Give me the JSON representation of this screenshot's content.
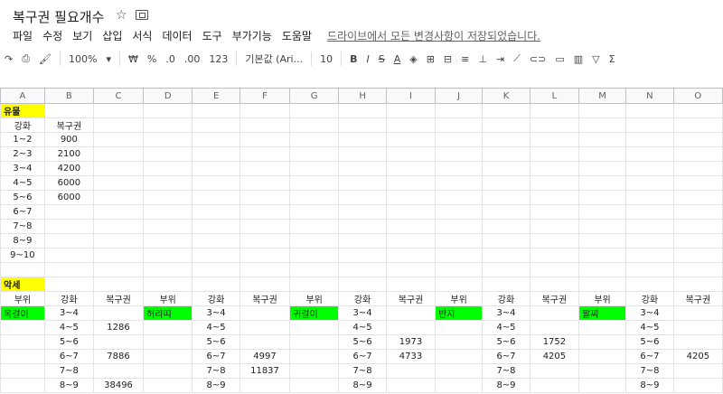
{
  "title": "복구권 필요개수",
  "menu": [
    "파일",
    "수정",
    "보기",
    "삽입",
    "서식",
    "데이터",
    "도구",
    "부가기능",
    "도움말"
  ],
  "save_status": "드라이브에서 모든 변경사항이 저장되었습니다.",
  "toolbar": {
    "zoom": "100%",
    "currency": "₩",
    "percent": "%",
    "dec_less": ".0",
    "dec_more": ".00",
    "format_more": "123",
    "font": "기본값 (Ari...",
    "font_size": "10"
  },
  "columns": [
    "A",
    "B",
    "C",
    "D",
    "E",
    "F",
    "G",
    "H",
    "I",
    "J",
    "K",
    "L",
    "M",
    "N",
    "O"
  ],
  "section1": {
    "label": "유물",
    "header": [
      "강화",
      "복구권"
    ],
    "rows": [
      [
        "1~2",
        "900"
      ],
      [
        "2~3",
        "2100"
      ],
      [
        "3~4",
        "4200"
      ],
      [
        "4~5",
        "6000"
      ],
      [
        "5~6",
        "6000"
      ],
      [
        "6~7",
        ""
      ],
      [
        "7~8",
        ""
      ],
      [
        "8~9",
        ""
      ],
      [
        "9~10",
        ""
      ]
    ]
  },
  "section2": {
    "label": "악세",
    "group_header": [
      "부위",
      "강화",
      "복구권"
    ],
    "groups": [
      {
        "part": "목걸이",
        "rows": [
          [
            "3~4",
            ""
          ],
          [
            "4~5",
            "1286"
          ],
          [
            "5~6",
            ""
          ],
          [
            "6~7",
            "7886"
          ],
          [
            "7~8",
            ""
          ],
          [
            "8~9",
            "38496"
          ]
        ]
      },
      {
        "part": "허리띠",
        "rows": [
          [
            "3~4",
            ""
          ],
          [
            "4~5",
            ""
          ],
          [
            "5~6",
            ""
          ],
          [
            "6~7",
            "4997"
          ],
          [
            "7~8",
            "11837"
          ],
          [
            "8~9",
            ""
          ]
        ]
      },
      {
        "part": "귀걸이",
        "rows": [
          [
            "3~4",
            ""
          ],
          [
            "4~5",
            ""
          ],
          [
            "5~6",
            "1973"
          ],
          [
            "6~7",
            "4733"
          ],
          [
            "7~8",
            ""
          ],
          [
            "8~9",
            ""
          ]
        ]
      },
      {
        "part": "반지",
        "rows": [
          [
            "3~4",
            ""
          ],
          [
            "4~5",
            ""
          ],
          [
            "5~6",
            "1752"
          ],
          [
            "6~7",
            "4205"
          ],
          [
            "7~8",
            ""
          ],
          [
            "8~9",
            ""
          ]
        ]
      },
      {
        "part": "팔찌",
        "rows": [
          [
            "3~4",
            ""
          ],
          [
            "4~5",
            ""
          ],
          [
            "5~6",
            ""
          ],
          [
            "6~7",
            "4205"
          ],
          [
            "7~8",
            ""
          ],
          [
            "8~9",
            ""
          ]
        ]
      }
    ]
  },
  "colors": {
    "section_highlight": "#ffff00",
    "part_highlight": "#00ff00"
  }
}
